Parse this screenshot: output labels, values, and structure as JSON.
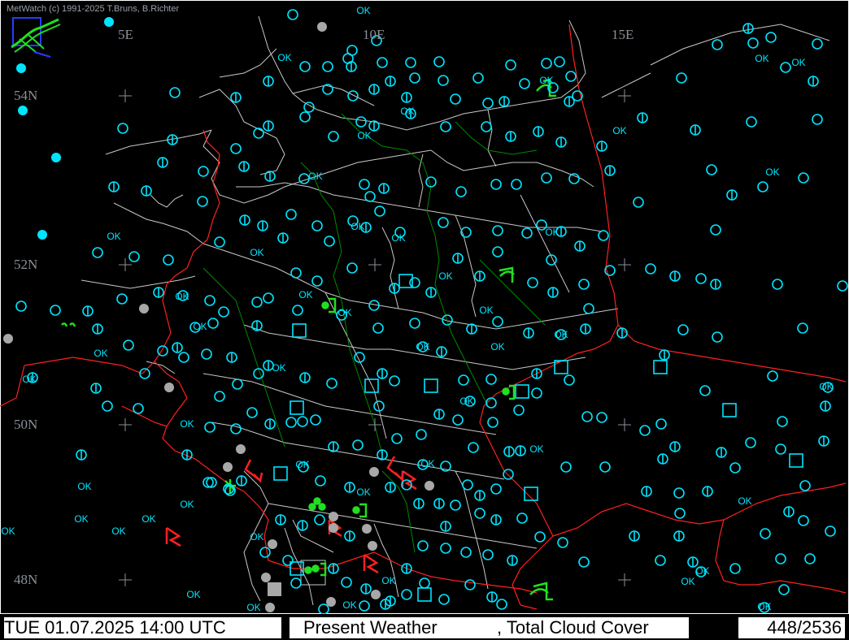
{
  "app": {
    "credit": "MetWatch  (c) 1991-2025 T.Bruns, B.Richter"
  },
  "map": {
    "longitude_labels": [
      "5E",
      "10E",
      "15E"
    ],
    "latitude_labels": [
      "54N",
      "52N",
      "50N",
      "48N"
    ],
    "colors": {
      "background": "#000000",
      "station": "#00e5ff",
      "boundary": "#d0d0d0",
      "border": "#ff2020",
      "river": "#008a00",
      "rain": "#20e020",
      "thunder": "#ff2020",
      "fog": "#a8a8a8"
    },
    "ok_label": "OK"
  },
  "status_bar": {
    "datetime": "TUE 01.07.2025 14:00 UTC",
    "product": "Present Weather",
    "overlay": ", Total Cloud Cover",
    "count": "448/2536"
  }
}
